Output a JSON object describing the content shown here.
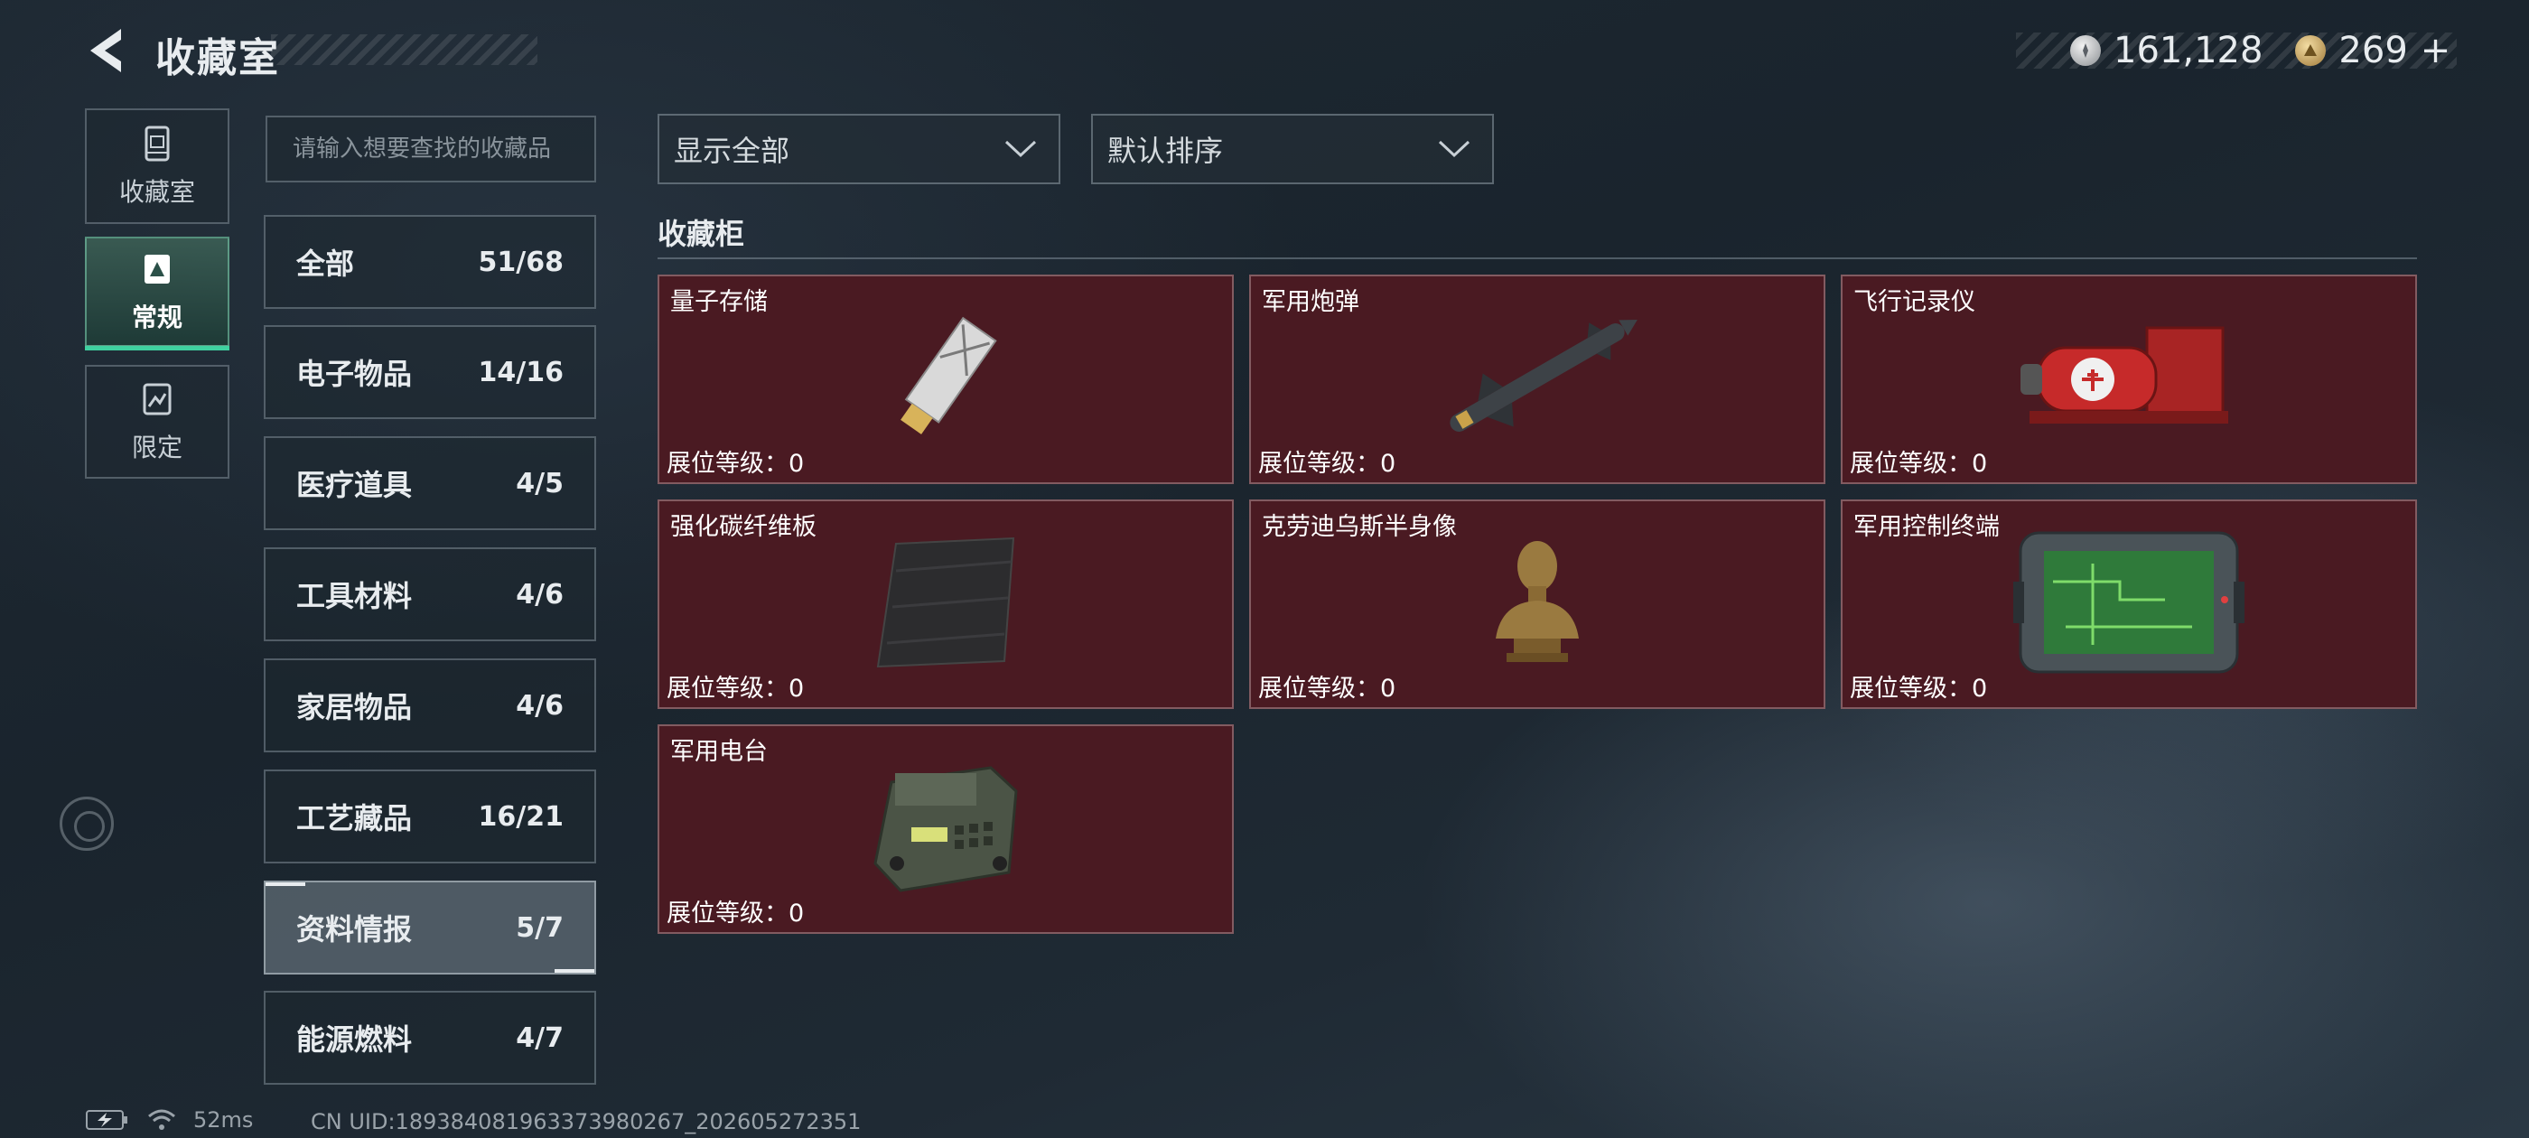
{
  "header": {
    "title": "收藏室",
    "currencies": [
      {
        "icon": "silver-coin-icon",
        "value": "161,128"
      },
      {
        "icon": "gold-coin-icon",
        "value": "269",
        "add": "+"
      }
    ]
  },
  "side_tabs": [
    {
      "label": "收藏室",
      "icon": "collection-room-icon"
    },
    {
      "label": "常规",
      "icon": "regular-icon",
      "active": true
    },
    {
      "label": "限定",
      "icon": "limited-icon"
    }
  ],
  "search": {
    "placeholder": "请输入想要查找的收藏品",
    "value": ""
  },
  "categories": [
    {
      "label": "全部",
      "count": "51/68"
    },
    {
      "label": "电子物品",
      "count": "14/16"
    },
    {
      "label": "医疗道具",
      "count": "4/5"
    },
    {
      "label": "工具材料",
      "count": "4/6"
    },
    {
      "label": "家居物品",
      "count": "4/6"
    },
    {
      "label": "工艺藏品",
      "count": "16/21"
    },
    {
      "label": "资料情报",
      "count": "5/7",
      "active": true
    },
    {
      "label": "能源燃料",
      "count": "4/7"
    }
  ],
  "filters": {
    "show": "显示全部",
    "sort": "默认排序"
  },
  "section": {
    "title": "收藏柜"
  },
  "items": [
    {
      "name": "量子存储",
      "level": "展位等级：0",
      "icon": "quantum-storage-icon"
    },
    {
      "name": "军用炮弹",
      "level": "展位等级：0",
      "icon": "missile-icon"
    },
    {
      "name": "飞行记录仪",
      "level": "展位等级：0",
      "icon": "flight-recorder-icon"
    },
    {
      "name": "强化碳纤维板",
      "level": "展位等级：0",
      "icon": "carbon-plate-icon"
    },
    {
      "name": "克劳迪乌斯半身像",
      "level": "展位等级：0",
      "icon": "bust-icon"
    },
    {
      "name": "军用控制终端",
      "level": "展位等级：0",
      "icon": "control-terminal-icon"
    },
    {
      "name": "军用电台",
      "level": "展位等级：0",
      "icon": "military-radio-icon"
    }
  ],
  "colors": {
    "card_bg": "#4a1a22",
    "accent": "#3fd1a0"
  },
  "status": {
    "ping": "52ms",
    "uid": "CN UID:1893840819633739802​67_202605272351"
  }
}
